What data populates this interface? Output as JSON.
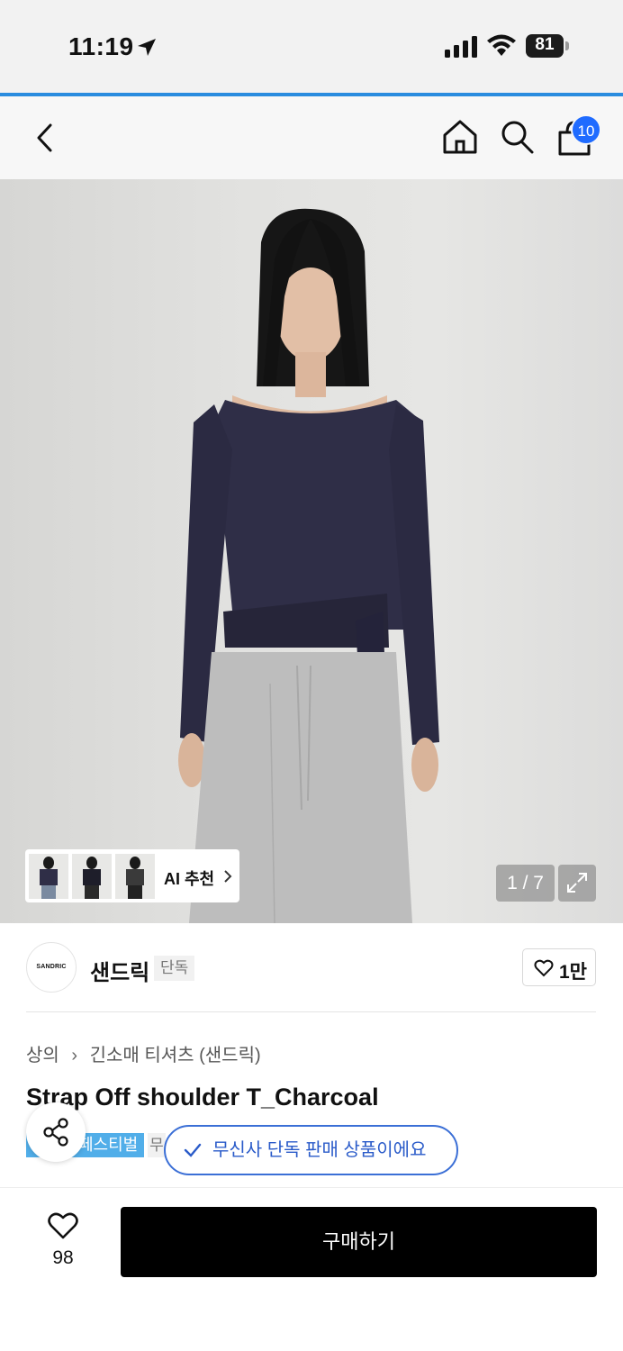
{
  "status_bar": {
    "time": "11:19",
    "battery": "81"
  },
  "nav": {
    "icons": [
      "back-icon",
      "home-icon",
      "search-icon",
      "cart-icon"
    ],
    "cart_badge": "10"
  },
  "gallery": {
    "counter": "1 / 7",
    "ai_recommend_label": "AI 추천",
    "thumbnails": 3
  },
  "brand": {
    "logo_text": "SANDRIC",
    "name": "샌드릭",
    "tag": "단독",
    "like_count": "1만"
  },
  "breadcrumb": [
    "상의",
    "긴소매 티셔츠 (샌드릭)"
  ],
  "product": {
    "title": "Strap Off shoulder T_Charcoal",
    "festival_tag": "페스티벌",
    "extra_tag": "무",
    "exclusive_notice": "무신사 단독 판매 상품이에요",
    "peek_text": "~ ~ ~"
  },
  "bottom_bar": {
    "wish_count": "98",
    "buy_label": "구매하기"
  },
  "colors": {
    "accent_blue": "#2a8cdf",
    "badge_blue": "#1f6bff",
    "festival_blue": "#51aee9",
    "exclusive_blue": "#2a5bc9",
    "buy_button": "#000000"
  }
}
